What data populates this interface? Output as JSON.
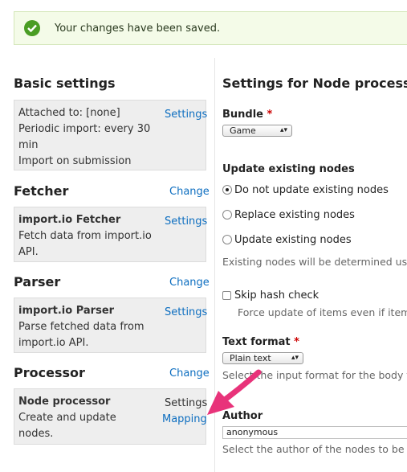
{
  "message": {
    "text": "Your changes have been saved."
  },
  "left": {
    "basic": {
      "title": "Basic settings",
      "lines": [
        "Attached to: [none]",
        "Periodic import: every 30",
        "min",
        "Import on submission"
      ],
      "settings_link": "Settings"
    },
    "fetcher": {
      "title": "Fetcher",
      "change": "Change",
      "name": "import.io Fetcher",
      "desc": [
        "Fetch data from import.io",
        "API."
      ],
      "settings_link": "Settings"
    },
    "parser": {
      "title": "Parser",
      "change": "Change",
      "name": "import.io Parser",
      "desc": [
        "Parse fetched data from",
        "import.io API."
      ],
      "settings_link": "Settings"
    },
    "processor": {
      "title": "Processor",
      "change": "Change",
      "name": "Node processor",
      "desc": [
        "Create and update",
        "nodes."
      ],
      "settings_text": "Settings",
      "mapping_link": "Mapping"
    }
  },
  "right": {
    "title": "Settings for Node processor",
    "bundle": {
      "label": "Bundle",
      "required_mark": "*",
      "value": "Game"
    },
    "update": {
      "label": "Update existing nodes",
      "options": [
        "Do not update existing nodes",
        "Replace existing nodes",
        "Update existing nodes"
      ],
      "selected": 0,
      "desc": "Existing nodes will be determined using"
    },
    "skip_hash": {
      "label": "Skip hash check",
      "desc": "Force update of items even if item so"
    },
    "text_format": {
      "label": "Text format",
      "required_mark": "*",
      "value": "Plain text",
      "desc": "Select the input format for the body fiel"
    },
    "author": {
      "label": "Author",
      "value": "anonymous",
      "desc": "Select the author of the nodes to be cre"
    }
  },
  "colors": {
    "accent_link": "#0d6ec0",
    "success": "#4a9d24",
    "annotation_arrow": "#e8337a"
  }
}
